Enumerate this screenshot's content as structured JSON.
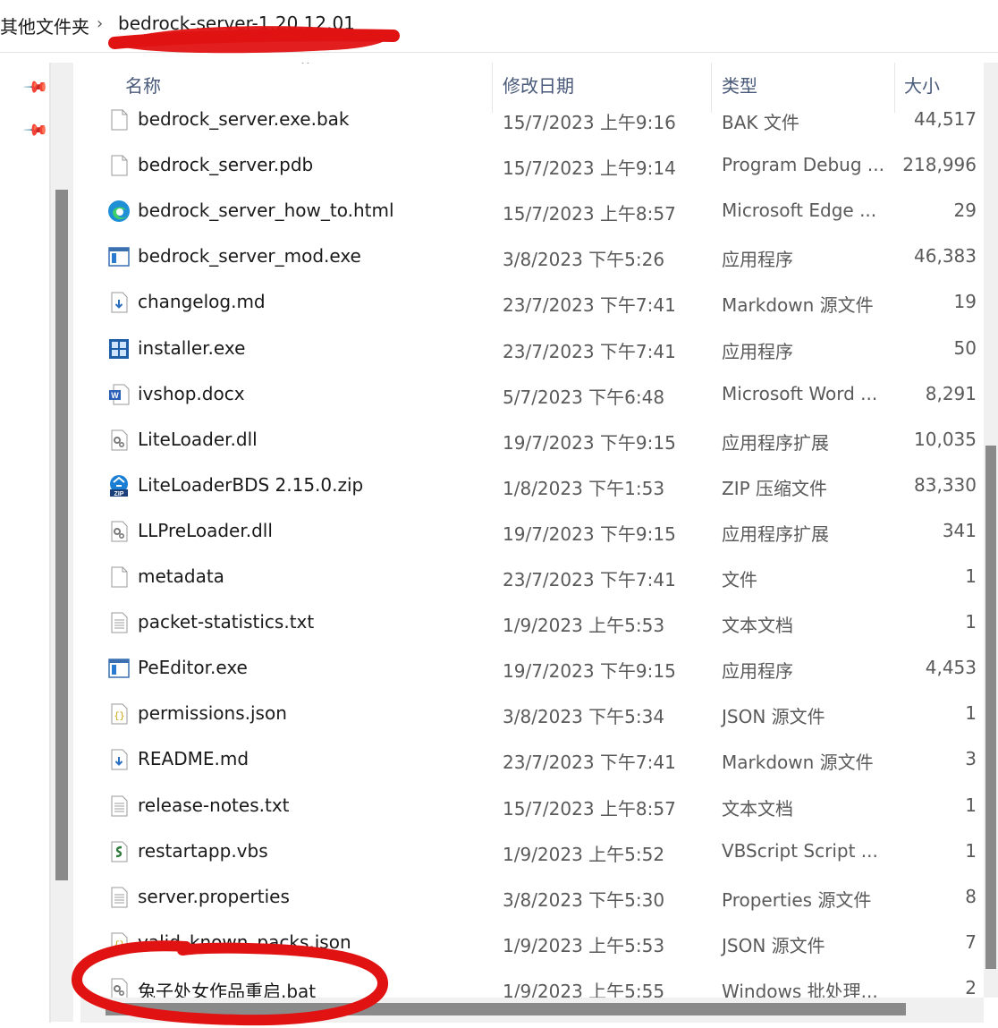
{
  "breadcrumb": {
    "parent": "其他文件夹",
    "separator": "›",
    "current": "bedrock-server-1.20.12.01"
  },
  "columns": {
    "name": "名称",
    "date": "修改日期",
    "type": "类型",
    "size": "大小"
  },
  "files": [
    {
      "name": "bedrock_server.exe.bak",
      "date": "15/7/2023 上午9:16",
      "type": "BAK 文件",
      "size": "44,517",
      "icon": "blank-file-icon"
    },
    {
      "name": "bedrock_server.pdb",
      "date": "15/7/2023 上午9:14",
      "type": "Program Debug ...",
      "size": "218,996",
      "icon": "blank-file-icon"
    },
    {
      "name": "bedrock_server_how_to.html",
      "date": "15/7/2023 上午8:57",
      "type": "Microsoft Edge ...",
      "size": "29",
      "icon": "edge-icon"
    },
    {
      "name": "bedrock_server_mod.exe",
      "date": "3/8/2023 下午5:26",
      "type": "应用程序",
      "size": "46,383",
      "icon": "app-window-icon"
    },
    {
      "name": "changelog.md",
      "date": "23/7/2023 下午7:41",
      "type": "Markdown 源文件",
      "size": "19",
      "icon": "markdown-icon"
    },
    {
      "name": "installer.exe",
      "date": "23/7/2023 下午7:41",
      "type": "应用程序",
      "size": "50",
      "icon": "installer-icon"
    },
    {
      "name": "ivshop.docx",
      "date": "5/7/2023 下午6:48",
      "type": "Microsoft Word ...",
      "size": "8,291",
      "icon": "word-icon"
    },
    {
      "name": "LiteLoader.dll",
      "date": "19/7/2023 下午9:15",
      "type": "应用程序扩展",
      "size": "10,035",
      "icon": "dll-gear-icon"
    },
    {
      "name": "LiteLoaderBDS 2.15.0.zip",
      "date": "1/8/2023 下午1:53",
      "type": "ZIP 压缩文件",
      "size": "83,330",
      "icon": "zip-icon"
    },
    {
      "name": "LLPreLoader.dll",
      "date": "19/7/2023 下午9:15",
      "type": "应用程序扩展",
      "size": "341",
      "icon": "dll-gear-icon"
    },
    {
      "name": "metadata",
      "date": "23/7/2023 下午7:41",
      "type": "文件",
      "size": "1",
      "icon": "blank-file-icon"
    },
    {
      "name": "packet-statistics.txt",
      "date": "1/9/2023 上午5:53",
      "type": "文本文档",
      "size": "1",
      "icon": "text-file-icon"
    },
    {
      "name": "PeEditor.exe",
      "date": "19/7/2023 下午9:15",
      "type": "应用程序",
      "size": "4,453",
      "icon": "app-window-icon"
    },
    {
      "name": "permissions.json",
      "date": "3/8/2023 下午5:34",
      "type": "JSON 源文件",
      "size": "1",
      "icon": "json-icon"
    },
    {
      "name": "README.md",
      "date": "23/7/2023 下午7:41",
      "type": "Markdown 源文件",
      "size": "3",
      "icon": "markdown-icon"
    },
    {
      "name": "release-notes.txt",
      "date": "15/7/2023 上午8:57",
      "type": "文本文档",
      "size": "1",
      "icon": "text-file-icon"
    },
    {
      "name": "restartapp.vbs",
      "date": "1/9/2023 上午5:52",
      "type": "VBScript Script ...",
      "size": "1",
      "icon": "vbs-script-icon"
    },
    {
      "name": "server.properties",
      "date": "3/8/2023 下午5:30",
      "type": "Properties 源文件",
      "size": "8",
      "icon": "text-file-icon"
    },
    {
      "name": "valid_known_packs.json",
      "date": "1/9/2023 上午5:53",
      "type": "JSON 源文件",
      "size": "7",
      "icon": "json-icon"
    },
    {
      "name": "兔子处女作品重启.bat",
      "date": "1/9/2023 上午5:55",
      "type": "Windows 批处理...",
      "size": "2",
      "icon": "bat-gear-icon"
    }
  ]
}
